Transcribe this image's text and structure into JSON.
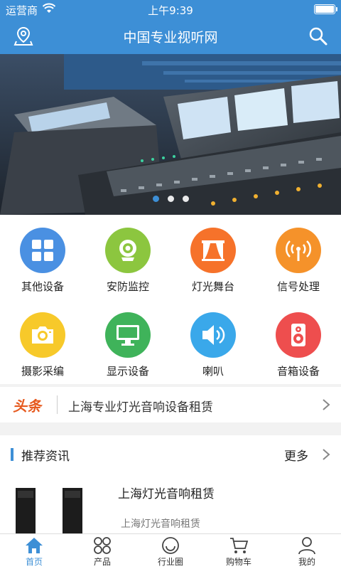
{
  "status_bar": {
    "carrier": "运营商",
    "time": "上午9:39"
  },
  "nav": {
    "title": "中国专业视听网",
    "location_icon": "location-icon",
    "search_icon": "search-icon"
  },
  "banner": {
    "slides": 3,
    "active_slide": 1
  },
  "categories": [
    {
      "label": "其他设备",
      "icon": "grid-icon",
      "color": "#4a90e2"
    },
    {
      "label": "安防监控",
      "icon": "webcam-icon",
      "color": "#8cc63f"
    },
    {
      "label": "灯光舞台",
      "icon": "stage-icon",
      "color": "#f6722a"
    },
    {
      "label": "信号处理",
      "icon": "signal-icon",
      "color": "#f5922a"
    },
    {
      "label": "摄影采编",
      "icon": "camera-icon",
      "color": "#f7c92a"
    },
    {
      "label": "显示设备",
      "icon": "monitor-icon",
      "color": "#3fb35a"
    },
    {
      "label": "喇叭",
      "icon": "speaker-icon",
      "color": "#3aa8ea"
    },
    {
      "label": "音箱设备",
      "icon": "speaker-box-icon",
      "color": "#ee4e4e"
    }
  ],
  "headline": {
    "tag": "头条",
    "text": "上海专业灯光音响设备租赁"
  },
  "recommend": {
    "title": "推荐资讯",
    "more": "更多",
    "article": {
      "title": "上海灯光音响租赁",
      "desc": "上海灯光音响租赁"
    }
  },
  "tabs": [
    {
      "label": "首页",
      "icon": "home-icon",
      "active": true
    },
    {
      "label": "产品",
      "icon": "products-icon",
      "active": false
    },
    {
      "label": "行业圈",
      "icon": "circle-icon",
      "active": false
    },
    {
      "label": "购物车",
      "icon": "cart-icon",
      "active": false
    },
    {
      "label": "我的",
      "icon": "user-icon",
      "active": false
    }
  ],
  "colors": {
    "primary": "#3d8fd6",
    "headline_tag": "#e65a1f"
  }
}
